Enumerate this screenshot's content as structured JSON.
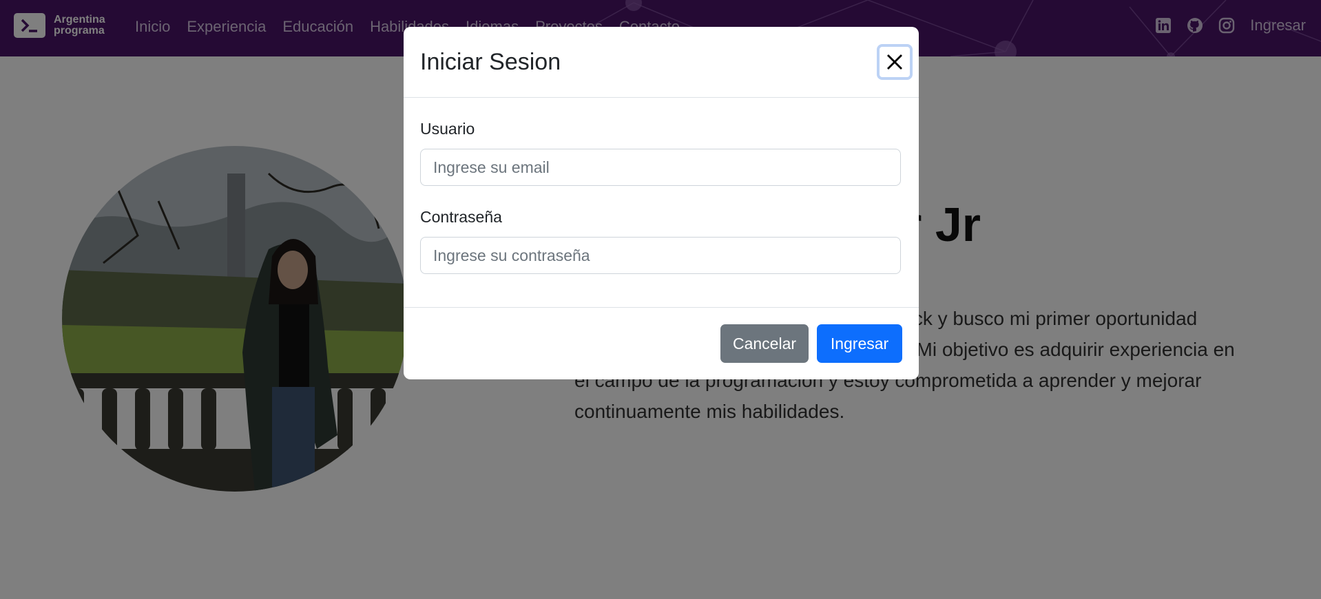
{
  "navbar": {
    "brand": {
      "line1": "Argentina",
      "line2": "programa",
      "icon": "terminal-prompt-icon"
    },
    "links": [
      "Inicio",
      "Experiencia",
      "Educación",
      "Habilidades",
      "Idiomas",
      "Proyectos",
      "Contacto"
    ],
    "social_icons": [
      "linkedin-icon",
      "github-icon",
      "instagram-icon"
    ],
    "login": "Ingresar",
    "background_color": "#4a1569"
  },
  "hero": {
    "title": "Web Developer Jr",
    "description": "Soy estudiante de programación full stack y busco mi primer oportunidad laboral como desarrolladora web junior. Mi objetivo es adquirir experiencia en el campo de la programación y estoy comprometida a aprender y mejorar continuamente mis habilidades."
  },
  "modal": {
    "title": "Iniciar Sesion",
    "user_label": "Usuario",
    "user_placeholder": "Ingrese su email",
    "user_value": "",
    "password_label": "Contraseña",
    "password_placeholder": "Ingrese su contraseña",
    "password_value": "",
    "cancel_label": "Cancelar",
    "submit_label": "Ingresar",
    "colors": {
      "cancel": "#6c757d",
      "submit": "#0d6efd",
      "backdrop": "rgba(0,0,0,0.5)"
    }
  }
}
